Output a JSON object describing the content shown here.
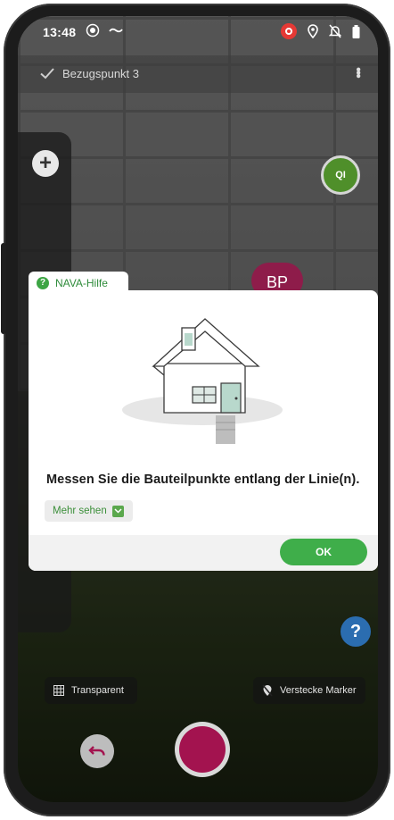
{
  "status_bar": {
    "time": "13:48",
    "icons_left": [
      "screen-record-icon",
      "wave-icon"
    ],
    "icons_right": [
      "recording-indicator-icon",
      "location-icon",
      "alarm-off-icon",
      "battery-icon"
    ]
  },
  "app_bar": {
    "title": "Bezugspunkt 3",
    "check_icon": "check-icon",
    "menu_icon": "more-vert-icon"
  },
  "ar_markers": {
    "qi": "QI",
    "bp": "BP"
  },
  "controls": {
    "plus_label": "+",
    "help_label": "?",
    "transparent_label": "Transparent",
    "hide_markers_label": "Verstecke Marker"
  },
  "dialog": {
    "tab_label": "NAVA-Hilfe",
    "tab_icon_text": "?",
    "message": "Messen Sie die Bauteilpunkte entlang der Linie(n).",
    "more_label": "Mehr sehen",
    "ok_label": "OK"
  },
  "colors": {
    "brand_green": "#3fae4a",
    "record_red": "#a3134f",
    "marker_qi": "#4f8f2a",
    "marker_bp": "#8e1c4a",
    "help_blue": "#2b6db0"
  }
}
